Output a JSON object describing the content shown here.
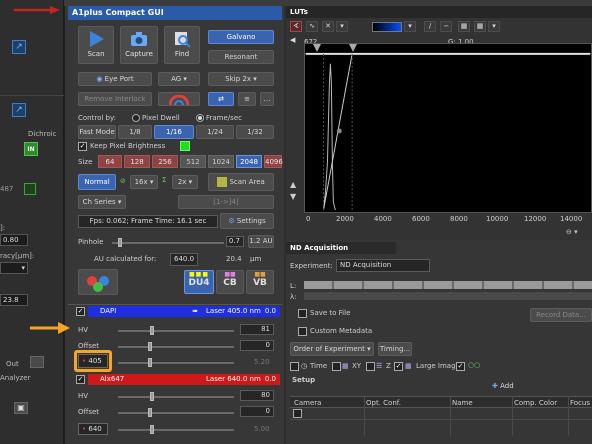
{
  "colors": {
    "accent": "#3a64b0",
    "dapi": "#1f2fe0",
    "alx": "#d01818",
    "highlight": "#f5a623",
    "annotation_red": "#c0281e"
  },
  "left": {
    "dichroic_label": "Dichroic",
    "in_label": "IN",
    "val_487": "487",
    "field_label_1": "]:",
    "field_val_1": "0.80",
    "accuracy_label": "racy[µm]:",
    "field_val_23": "23.8",
    "out_label": "Out",
    "analyzer_label": "Analyzer"
  },
  "a1": {
    "title": "A1plus Compact GUI",
    "scan": "Scan",
    "capture": "Capture",
    "find": "Find",
    "galvano": "Galvano",
    "resonant": "Resonant",
    "eye_port": "Eye Port",
    "ag": "AG",
    "skip": "Skip 2x",
    "remove_interlock": "Remove Interlock",
    "control_by": "Control by:",
    "pixel_dwell": "Pixel Dwell",
    "frame_sec": "Frame/sec",
    "fast_mode": "Fast Mode",
    "fr_1_8": "1/8",
    "fr_1_16": "1/16",
    "fr_1_24": "1/24",
    "fr_1_32": "1/32",
    "keep_brightness": "Keep Pixel Brightness",
    "size_label": "Size",
    "sizes": [
      "64",
      "128",
      "256",
      "512",
      "1024",
      "2048",
      "4096"
    ],
    "normal": "Normal",
    "zoom_16x": "16x",
    "sum_2x": "2x",
    "scan_area": "Scan Area",
    "ch_series": "Ch Series",
    "ch_range": "[1->]4]",
    "fps_text": "Fps: 0.062; Frame Time: 16.1 sec",
    "settings": "Settings",
    "pinhole": "Pinhole",
    "pinhole_val": "0.7",
    "pinhole_au": "1.2 AU",
    "au_calc": "AU calculated for:",
    "au_nm": "640.0",
    "au_um_val": "20.4",
    "au_um": "µm",
    "du4": "DU4",
    "cb": "CB",
    "vb": "VB",
    "dapi": {
      "name": "DAPI",
      "laser": "Laser 405.0 nm",
      "laser_val": "0.0",
      "hv_label": "HV",
      "hv_val": "81",
      "offset_label": "Offset",
      "offset_val": "0",
      "wavelength": "405",
      "power_val": "5.20"
    },
    "alx": {
      "name": "Alx647",
      "laser": "Laser 640.0 nm",
      "laser_val": "0.0",
      "hv_label": "HV",
      "hv_val": "80",
      "offset_label": "Offset",
      "offset_val": "0",
      "wavelength": "640",
      "power_val": "5.00"
    }
  },
  "luts": {
    "title": "LUTs",
    "left_val": "672",
    "gamma": "G: 1.00",
    "ticks": [
      "0",
      "2000",
      "4000",
      "6000",
      "8000",
      "10000",
      "12000",
      "14000"
    ]
  },
  "nd": {
    "tab": "ND Acquisition",
    "experiment_label": "Experiment:",
    "experiment_val": "ND Acquisition",
    "row_L": "L:",
    "row_lambda": "λ:",
    "save_to_file": "Save to File",
    "record_data": "Record Data...",
    "custom_metadata": "Custom Metadata",
    "order_label": "Order of Experiment",
    "timing": "Timing...",
    "tab_time": "Time",
    "tab_xy": "XY",
    "tab_z": "Z",
    "tab_large": "Large Image",
    "setup": "Setup",
    "add": "Add",
    "columns": [
      "Camera",
      "Opt. Conf.",
      "Name",
      "Comp. Color",
      "Focus"
    ]
  }
}
